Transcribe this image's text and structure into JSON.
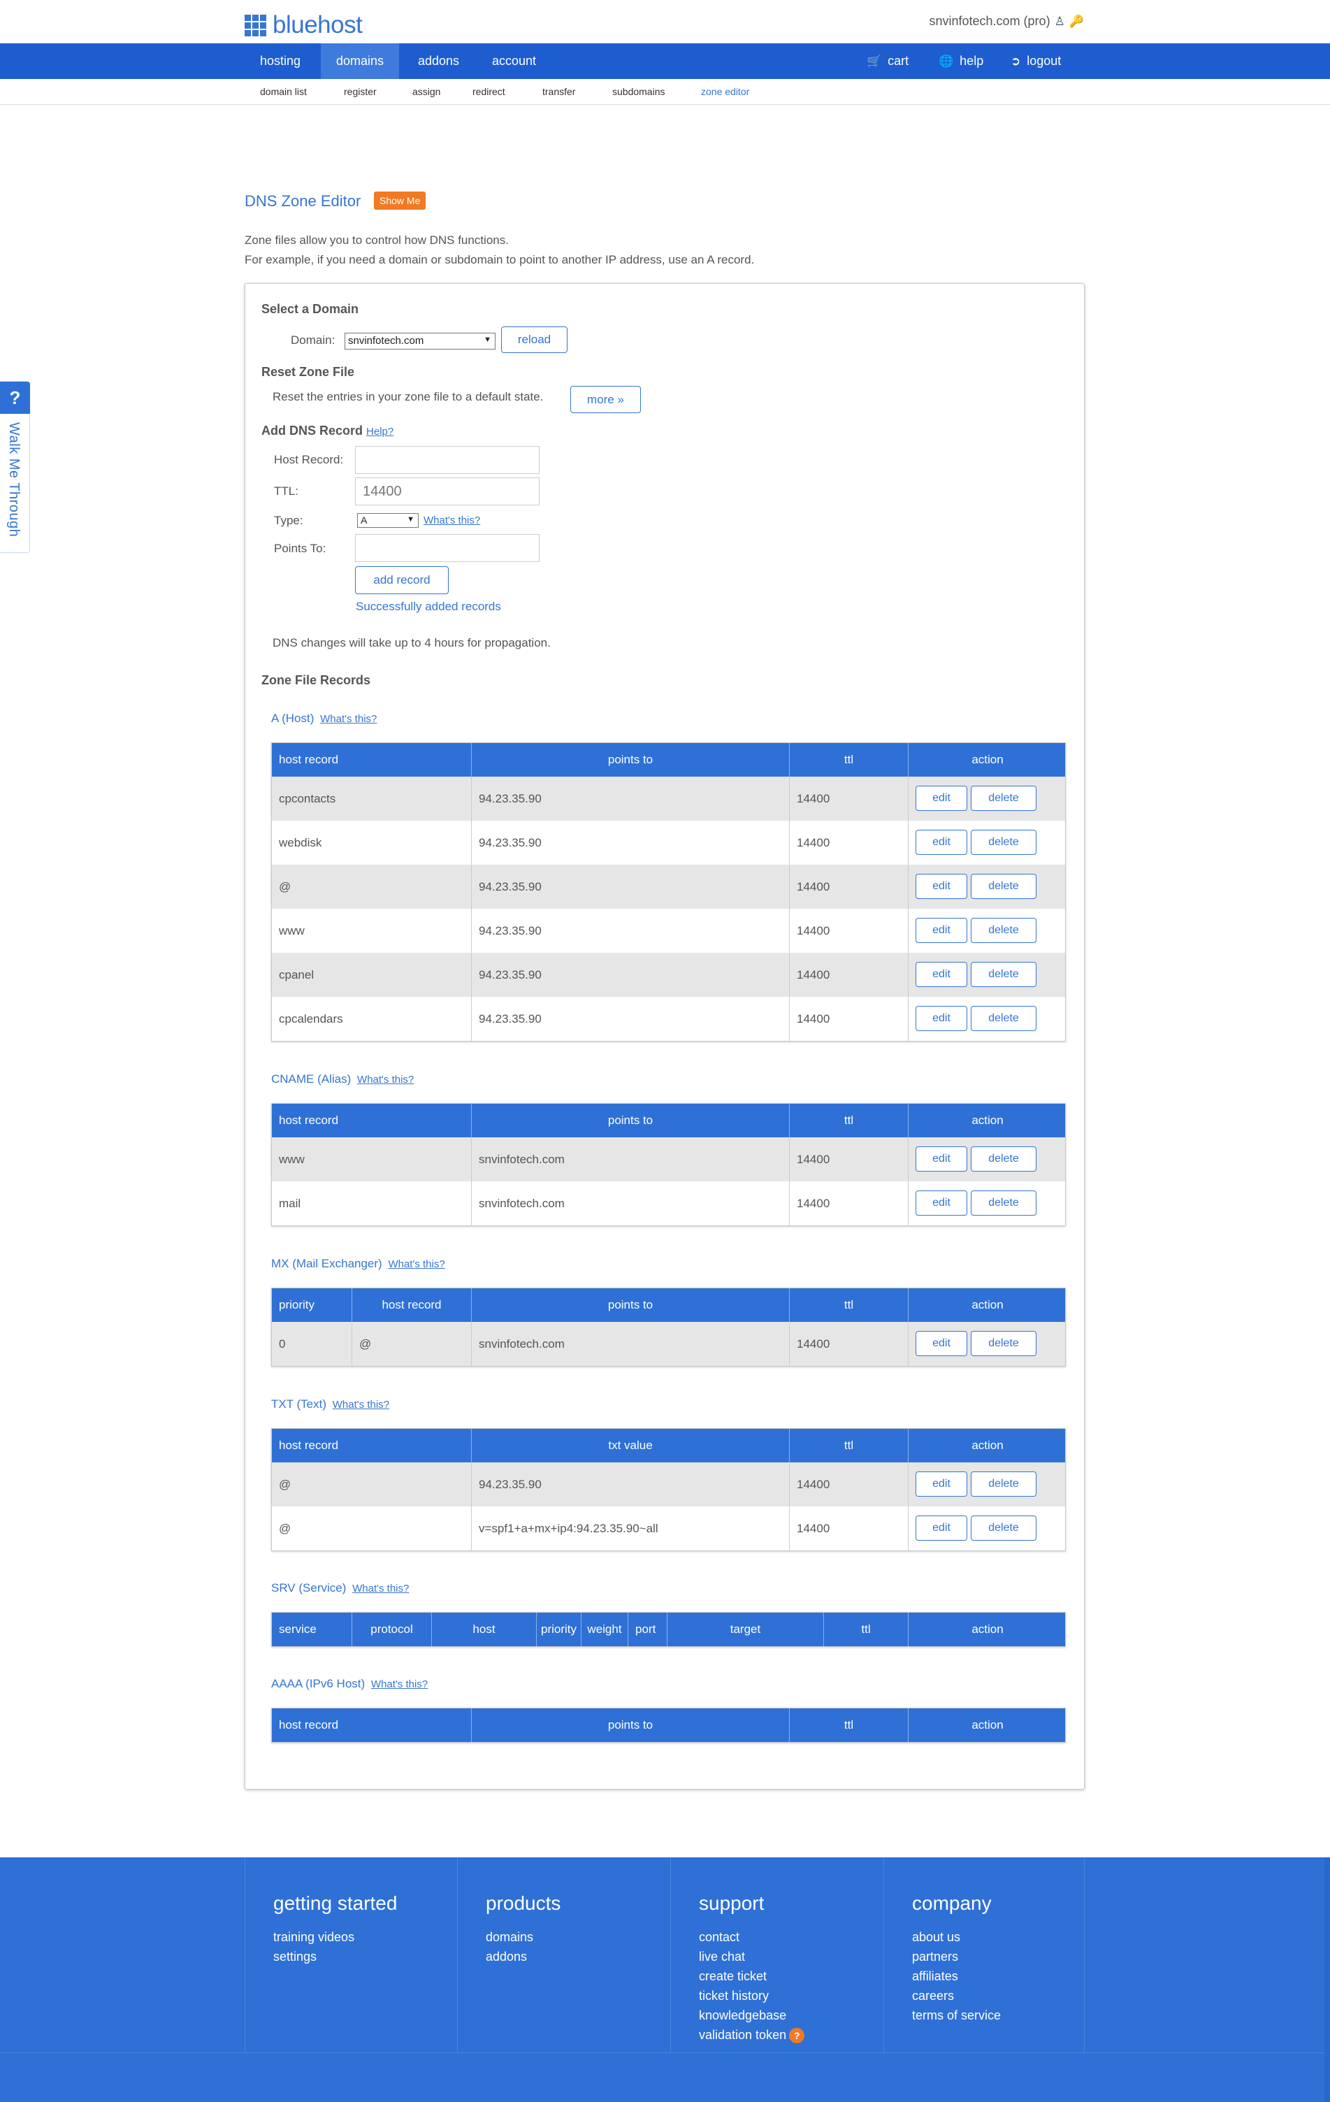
{
  "header": {
    "logo_text": "bluehost",
    "account_label": "snvinfotech.com (pro)",
    "user_icon": "user-icon",
    "key_icon": "key-icon"
  },
  "nav": {
    "hosting": "hosting",
    "domains": "domains",
    "addons": "addons",
    "account": "account",
    "cart": "cart",
    "help": "help",
    "logout": "logout"
  },
  "subnav": {
    "domain_list": "domain list",
    "register": "register",
    "assign": "assign",
    "redirect": "redirect",
    "transfer": "transfer",
    "subdomains": "subdomains",
    "zone_editor": "zone editor"
  },
  "walk": {
    "q": "?",
    "label": "Walk Me Through"
  },
  "page": {
    "title": "DNS Zone Editor",
    "show_me": "Show Me",
    "intro1": "Zone files allow you to control how DNS functions.",
    "intro2": "For example, if you need a domain or subdomain to point to another IP address, use an A record."
  },
  "select_domain": {
    "title": "Select a Domain",
    "domain_label": "Domain:",
    "domain_value": "snvinfotech.com",
    "reload": "reload"
  },
  "reset": {
    "title": "Reset Zone File",
    "text": "Reset the entries in your zone file to a default state.",
    "more": "more »"
  },
  "add_record": {
    "title": "Add DNS Record",
    "help": "Help?",
    "host_label": "Host Record:",
    "host_value": "",
    "ttl_label": "TTL:",
    "ttl_value": "14400",
    "type_label": "Type:",
    "type_value": "A",
    "whats_this": "What's this?",
    "points_label": "Points To:",
    "points_value": "",
    "add_button": "add record",
    "success": "Successfully added records",
    "propagation": "DNS changes will take up to 4 hours for propagation."
  },
  "zone_records_title": "Zone File Records",
  "whats_this": "What's this?",
  "edit_label": "edit",
  "delete_label": "delete",
  "a_records": {
    "title": "A (Host)",
    "headers": [
      "host record",
      "points to",
      "ttl",
      "action"
    ],
    "rows": [
      [
        "cpcontacts",
        "94.23.35.90",
        "14400"
      ],
      [
        "webdisk",
        "94.23.35.90",
        "14400"
      ],
      [
        "@",
        "94.23.35.90",
        "14400"
      ],
      [
        "www",
        "94.23.35.90",
        "14400"
      ],
      [
        "cpanel",
        "94.23.35.90",
        "14400"
      ],
      [
        "cpcalendars",
        "94.23.35.90",
        "14400"
      ]
    ]
  },
  "cname_records": {
    "title": "CNAME (Alias)",
    "headers": [
      "host record",
      "points to",
      "ttl",
      "action"
    ],
    "rows": [
      [
        "www",
        "snvinfotech.com",
        "14400"
      ],
      [
        "mail",
        "snvinfotech.com",
        "14400"
      ]
    ]
  },
  "mx_records": {
    "title": "MX (Mail Exchanger)",
    "headers": [
      "priority",
      "host record",
      "points to",
      "ttl",
      "action"
    ],
    "rows": [
      [
        "0",
        "@",
        "snvinfotech.com",
        "14400"
      ]
    ]
  },
  "txt_records": {
    "title": "TXT (Text)",
    "headers": [
      "host record",
      "txt value",
      "ttl",
      "action"
    ],
    "rows": [
      [
        "@",
        "94.23.35.90",
        "14400"
      ],
      [
        "@",
        "v=spf1+a+mx+ip4:94.23.35.90~all",
        "14400"
      ]
    ]
  },
  "srv_records": {
    "title": "SRV (Service)",
    "headers": [
      "service",
      "protocol",
      "host",
      "priority",
      "weight",
      "port",
      "target",
      "ttl",
      "action"
    ]
  },
  "aaaa_records": {
    "title": "AAAA (IPv6 Host)",
    "headers": [
      "host record",
      "points to",
      "ttl",
      "action"
    ]
  },
  "footer": {
    "getting_started": {
      "title": "getting started",
      "links": [
        "training videos",
        "settings"
      ]
    },
    "products": {
      "title": "products",
      "links": [
        "domains",
        "addons"
      ]
    },
    "support": {
      "title": "support",
      "links": [
        "contact",
        "live chat",
        "create ticket",
        "ticket history",
        "knowledgebase",
        "validation token"
      ],
      "badge": "?"
    },
    "company": {
      "title": "company",
      "links": [
        "about us",
        "partners",
        "affiliates",
        "careers",
        "terms of service"
      ]
    }
  },
  "colors": {
    "brand_blue": "#1d5dd0",
    "table_header": "#2e70d6",
    "link_blue": "#3575d3",
    "accent_orange": "#f17a22"
  }
}
